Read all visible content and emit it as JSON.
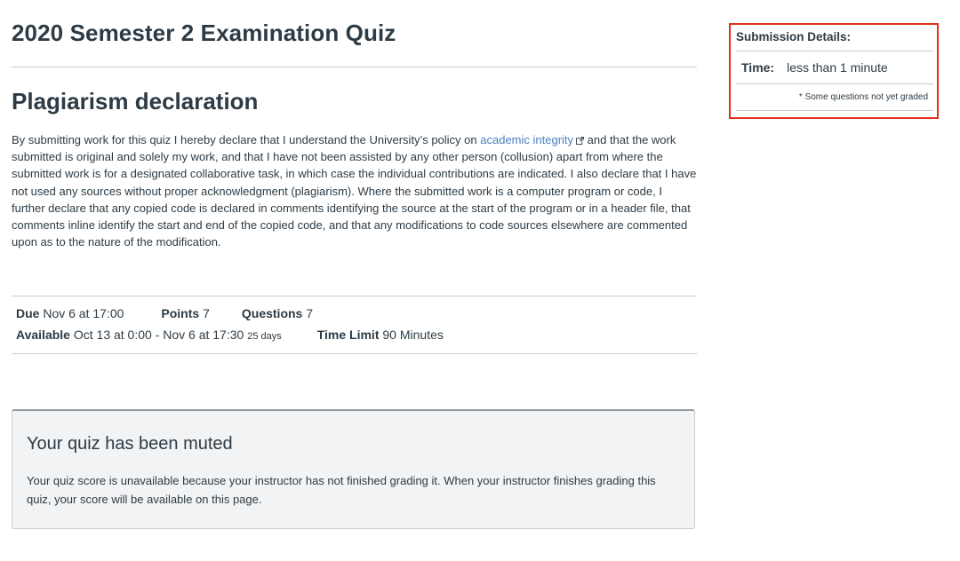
{
  "quiz": {
    "title": "2020 Semester 2 Examination Quiz"
  },
  "declaration": {
    "heading": "Plagiarism declaration",
    "text_before": "By submitting work for this quiz I hereby declare that I understand the University’s policy on ",
    "link_text": "academic integrity",
    "text_after": " and that the work submitted is original and solely my work, and that I have not been assisted by any other person (collusion) apart from where the submitted work is for a designated collaborative task, in which case the individual contributions are indicated. I also declare that I have not used any sources without proper acknowledgment (plagiarism). Where the submitted work is a computer program or code, I further declare that any copied code is declared in comments identifying the source at the start of the program or in a header file, that comments inline identify the start and end of the copied code, and that any modifications to code sources elsewhere are commented upon as to the nature of the modification."
  },
  "details": {
    "due_label": "Due",
    "due_value": "Nov 6 at 17:00",
    "points_label": "Points",
    "points_value": "7",
    "questions_label": "Questions",
    "questions_value": "7",
    "available_label": "Available",
    "available_value": "Oct 13 at 0:00 - Nov 6 at 17:30",
    "available_days": "25 days",
    "time_limit_label": "Time Limit",
    "time_limit_value": "90 Minutes"
  },
  "muted": {
    "title": "Your quiz has been muted",
    "text": "Your quiz score is unavailable because your instructor has not finished grading it. When your instructor finishes grading this quiz, your score will be available on this page."
  },
  "submission": {
    "header": "Submission Details:",
    "time_label": "Time:",
    "time_value": "less than 1 minute",
    "note": "* Some questions not yet graded"
  },
  "colors": {
    "link": "#4a7fbf",
    "highlight_border": "#e0301e",
    "text": "#2d3b45"
  },
  "icons": {
    "external_link": "external-link-icon"
  }
}
